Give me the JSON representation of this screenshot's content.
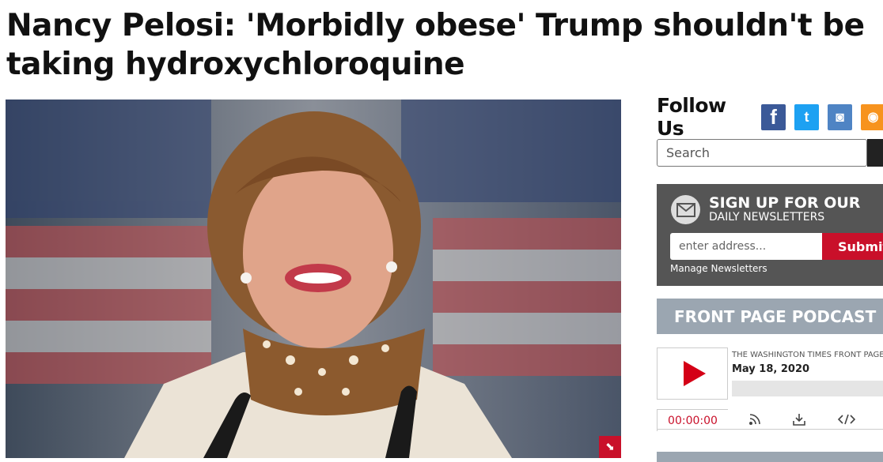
{
  "article": {
    "headline_line1": "Nancy Pelosi: 'Morbidly obese' Trump shouldn't be",
    "headline_line2": "taking hydroxychloroquine"
  },
  "photo": {
    "expand_icon": "expand-icon"
  },
  "sidebar": {
    "follow_label": "Follow Us",
    "social": [
      {
        "name": "facebook-icon",
        "glyph": "f"
      },
      {
        "name": "twitter-icon",
        "glyph": "t"
      },
      {
        "name": "instagram-icon",
        "glyph": "◙"
      },
      {
        "name": "rss-icon",
        "glyph": "◉"
      }
    ],
    "search_placeholder": "Search",
    "newsletter": {
      "title": "SIGN UP FOR OUR",
      "subtitle": "DAILY NEWSLETTERS",
      "input_placeholder": "enter address...",
      "submit_label": "Submit",
      "manage_label": "Manage Newsletters"
    },
    "podcast": {
      "section_title": "FRONT PAGE PODCAST",
      "show_name": "THE WASHINGTON TIMES FRONT PAGE",
      "date": "May 18, 2020",
      "time": "00:00:00"
    }
  },
  "colors": {
    "accent_red": "#c9102a",
    "newsletter_bg": "#555555",
    "section_bar": "#9ba6b1"
  }
}
